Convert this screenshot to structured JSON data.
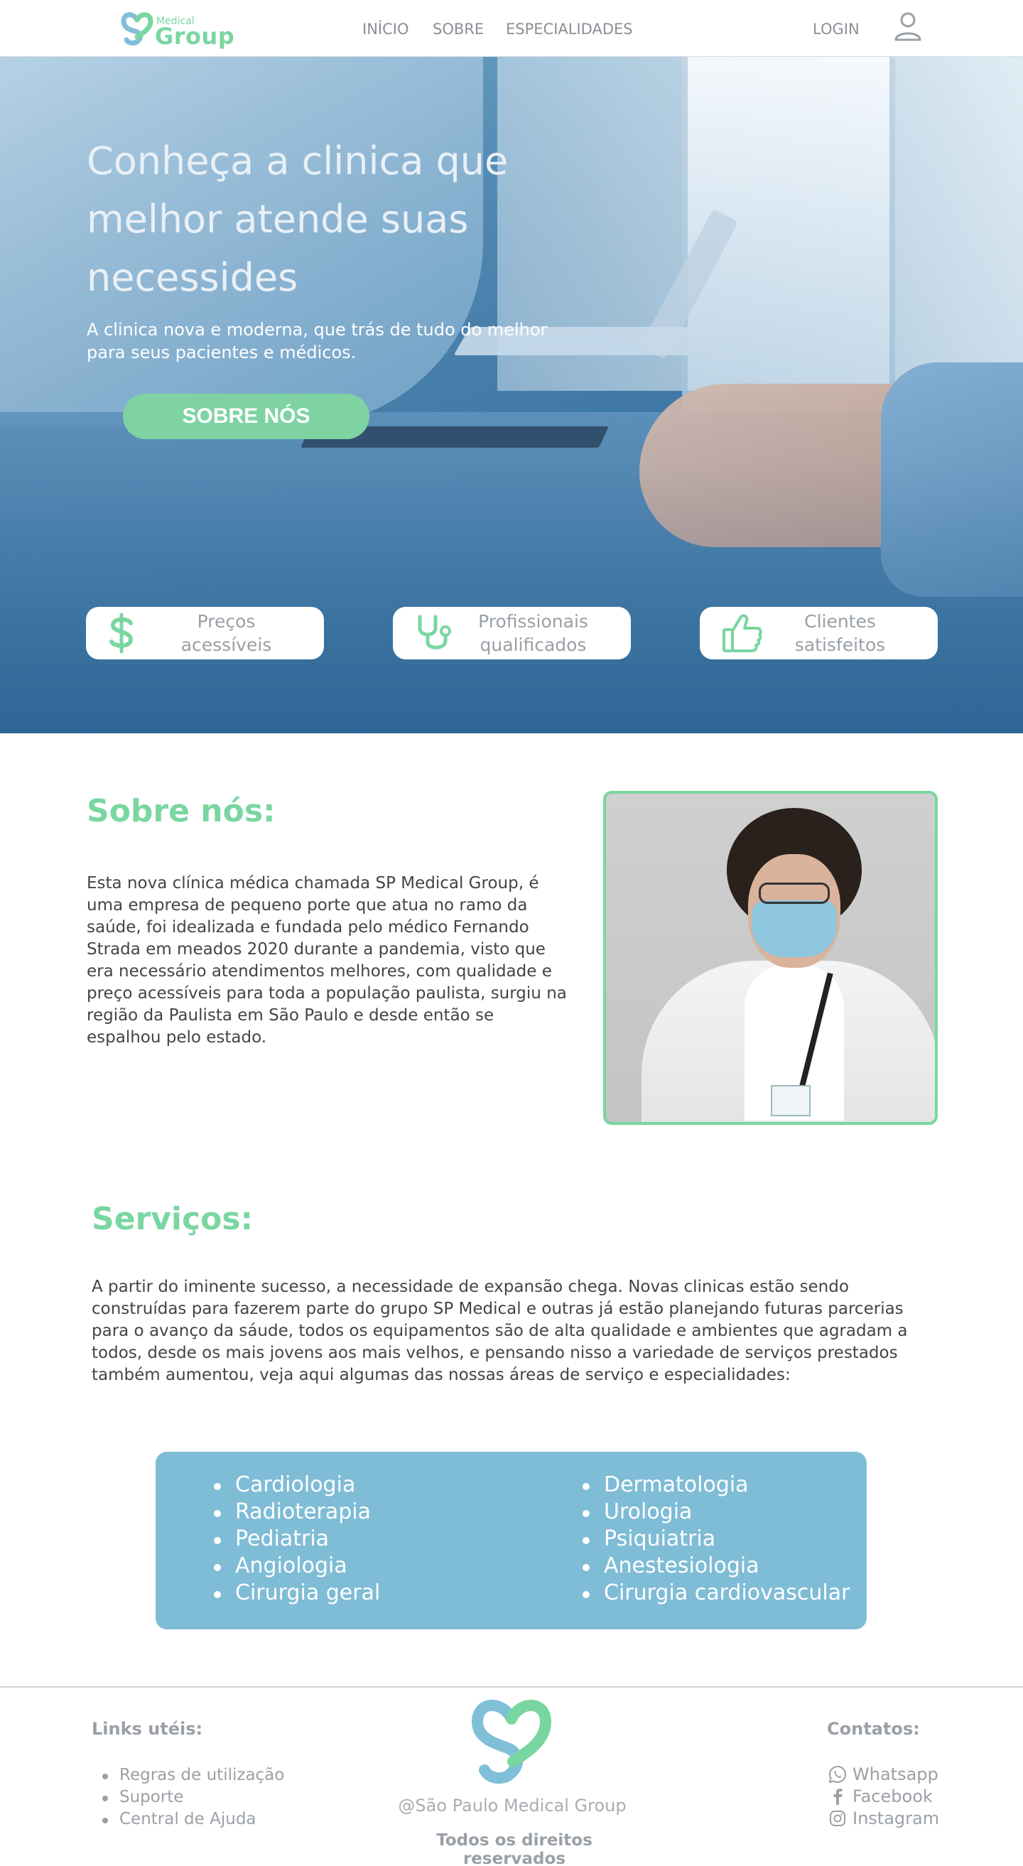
{
  "header": {
    "logo_small": "Medical",
    "logo_big": "Group",
    "nav": [
      "INÍCIO",
      "SOBRE",
      "ESPECIALIDADES"
    ],
    "login": "LOGIN"
  },
  "hero": {
    "title": "Conheça a clinica que melhor atende suas necessides",
    "subtitle": "A clinica nova e moderna, que trás de tudo do melhor para seus pacientes e médicos.",
    "button": "SOBRE NÓS",
    "features": [
      {
        "icon": "dollar-icon",
        "label_line1": "Preços",
        "label_line2": "acessíveis"
      },
      {
        "icon": "stethoscope-icon",
        "label_line1": "Profissionais",
        "label_line2": "qualificados"
      },
      {
        "icon": "thumbs-up-icon",
        "label_line1": "Clientes",
        "label_line2": "satisfeitos"
      }
    ]
  },
  "sobre": {
    "title": "Sobre nós:",
    "text": "Esta nova clínica médica chamada SP Medical Group, é uma empresa de pequeno porte que atua no ramo da saúde, foi idealizada e fundada pelo médico Fernando Strada em meados 2020 durante a pandemia, visto que era necessário atendimentos melhores, com qualidade e preço acessíveis para toda a população paulista, surgiu na região da  Paulista em São Paulo e desde então se espalhou pelo estado."
  },
  "servicos": {
    "title": "Serviços:",
    "text": "A partir do iminente sucesso, a necessidade de expansão chega. Novas clinicas estão sendo construídas para fazerem parte do grupo SP Medical e outras já estão planejando futuras parcerias para o avanço da sáude, todos os equipamentos são de alta qualidade e ambientes que agradam a todos, desde os mais jovens aos mais velhos, e pensando nisso a variedade de serviços prestados também aumentou, veja aqui algumas das nossas áreas de serviço e especialidades:",
    "col_a": [
      "Cardiologia",
      "Radioterapia",
      "Pediatria",
      "Angiologia",
      "Cirurgia geral"
    ],
    "col_b": [
      "Dermatologia",
      "Urologia",
      "Psiquiatria",
      "Anestesiologia",
      "Cirurgia cardiovascular"
    ]
  },
  "footer": {
    "links_title": "Links utéis:",
    "links": [
      "Regras de utilização",
      "Suporte",
      "Central de Ajuda"
    ],
    "copyright": "@São Paulo Medical Group",
    "rights": "Todos os direitos reservados",
    "contacts_title": "Contatos:",
    "contacts": [
      {
        "icon": "whatsapp-icon",
        "label": "Whatsapp"
      },
      {
        "icon": "facebook-icon",
        "label": "Facebook"
      },
      {
        "icon": "instagram-icon",
        "label": "Instagram"
      }
    ]
  },
  "colors": {
    "accent_green": "#7ad6a1",
    "accent_blue": "#7fbcd6",
    "muted_text": "#9aa0a6"
  }
}
